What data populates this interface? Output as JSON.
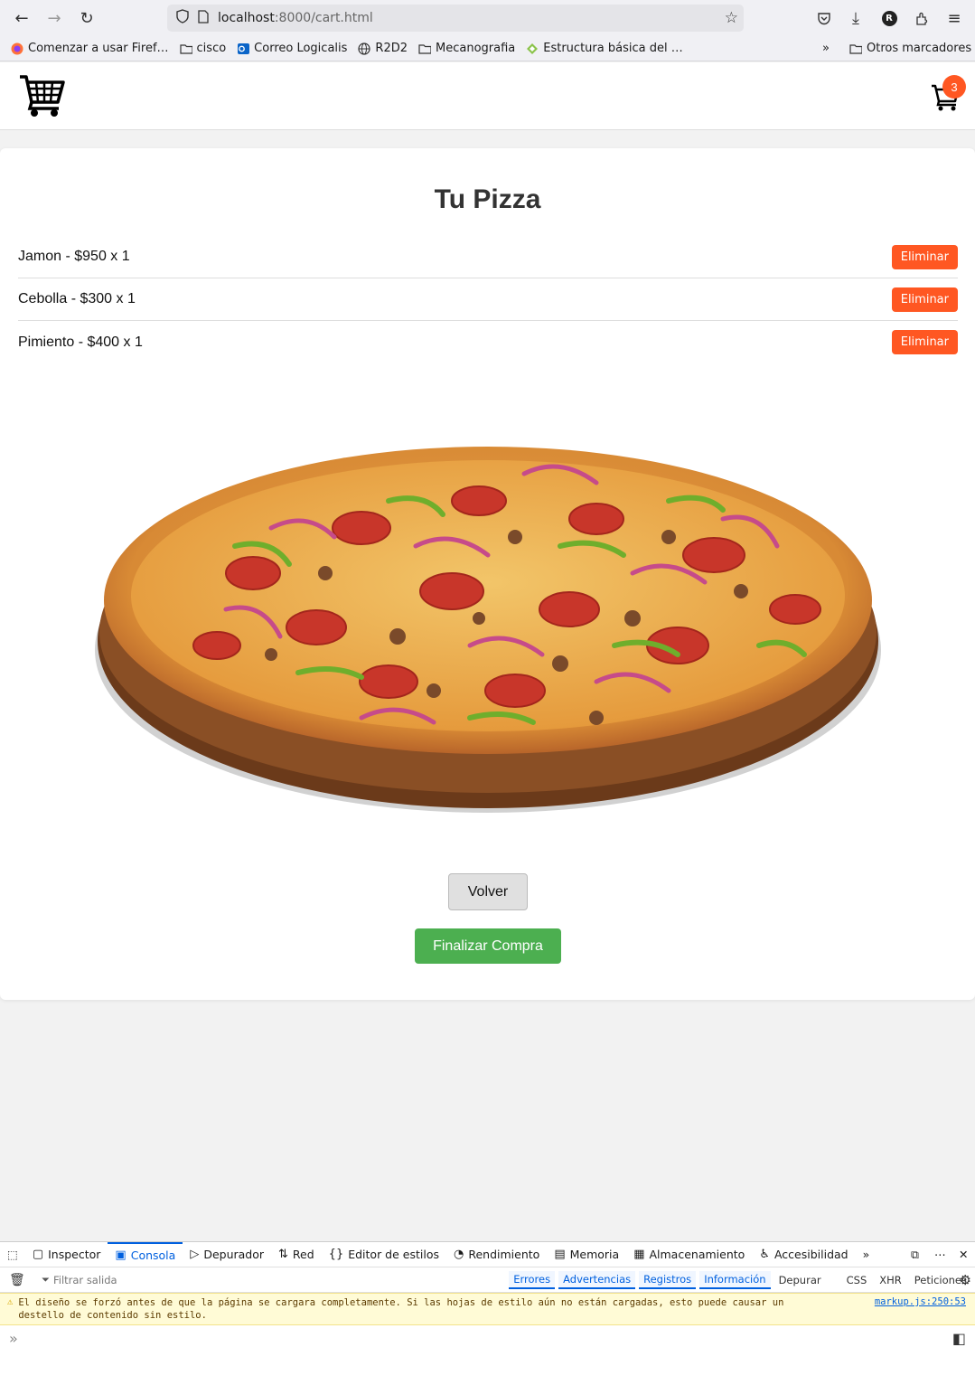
{
  "browser": {
    "url_host": "localhost",
    "url_path": ":8000/cart.html",
    "profile_initial": "R",
    "bookmarks": [
      {
        "label": "Comenzar a usar Firef…",
        "icon": "firefox-icon"
      },
      {
        "label": "cisco",
        "icon": "folder-icon"
      },
      {
        "label": "Correo Logicalis",
        "icon": "outlook-icon"
      },
      {
        "label": "R2D2",
        "icon": "globe-icon"
      },
      {
        "label": "Mecanografia",
        "icon": "folder-icon"
      },
      {
        "label": "Estructura básica del …",
        "icon": "leaf-icon"
      }
    ],
    "other_bookmarks": "Otros marcadores"
  },
  "header": {
    "cart_count": "3"
  },
  "cart": {
    "title": "Tu Pizza",
    "items": [
      {
        "text": "Jamon - $950 x 1",
        "remove_label": "Eliminar"
      },
      {
        "text": "Cebolla - $300 x 1",
        "remove_label": "Eliminar"
      },
      {
        "text": "Pimiento - $400 x 1",
        "remove_label": "Eliminar"
      }
    ],
    "back_label": "Volver",
    "finish_label": "Finalizar Compra"
  },
  "devtools": {
    "tabs": [
      "Inspector",
      "Consola",
      "Depurador",
      "Red",
      "Editor de estilos",
      "Rendimiento",
      "Memoria",
      "Almacenamiento",
      "Accesibilidad"
    ],
    "active_tab": "Consola",
    "filter_placeholder": "Filtrar salida",
    "filters": [
      "Errores",
      "Advertencias",
      "Registros",
      "Información",
      "Depurar"
    ],
    "extra_filters": [
      "CSS",
      "XHR",
      "Peticiones"
    ],
    "warning_message": "El diseño se forzó antes de que la página se cargara completamente. Si las hojas de estilo aún no están cargadas, esto puede causar un destello de contenido sin estilo.",
    "warning_source": "markup.js:250:53"
  },
  "colors": {
    "accent_remove": "#ff5722",
    "accent_finish": "#4caf50",
    "badge": "#ff5722"
  }
}
